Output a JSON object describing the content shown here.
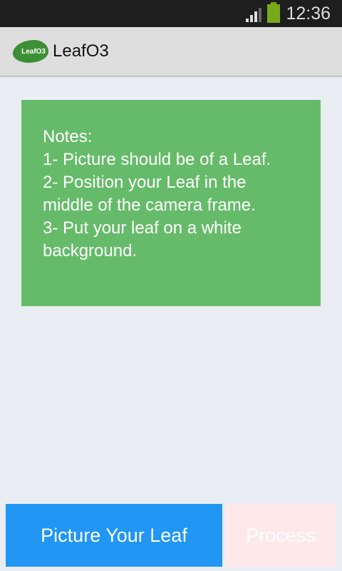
{
  "status": {
    "time": "12:36"
  },
  "app": {
    "title": "LeafO3",
    "logo_text": "LeafO3"
  },
  "notes": {
    "text": "Notes:\n1- Picture should be of a Leaf.\n2- Position your Leaf in the middle of the camera frame.\n3- Put your leaf on a white background."
  },
  "buttons": {
    "picture": "Picture Your Leaf",
    "process": "Process"
  }
}
